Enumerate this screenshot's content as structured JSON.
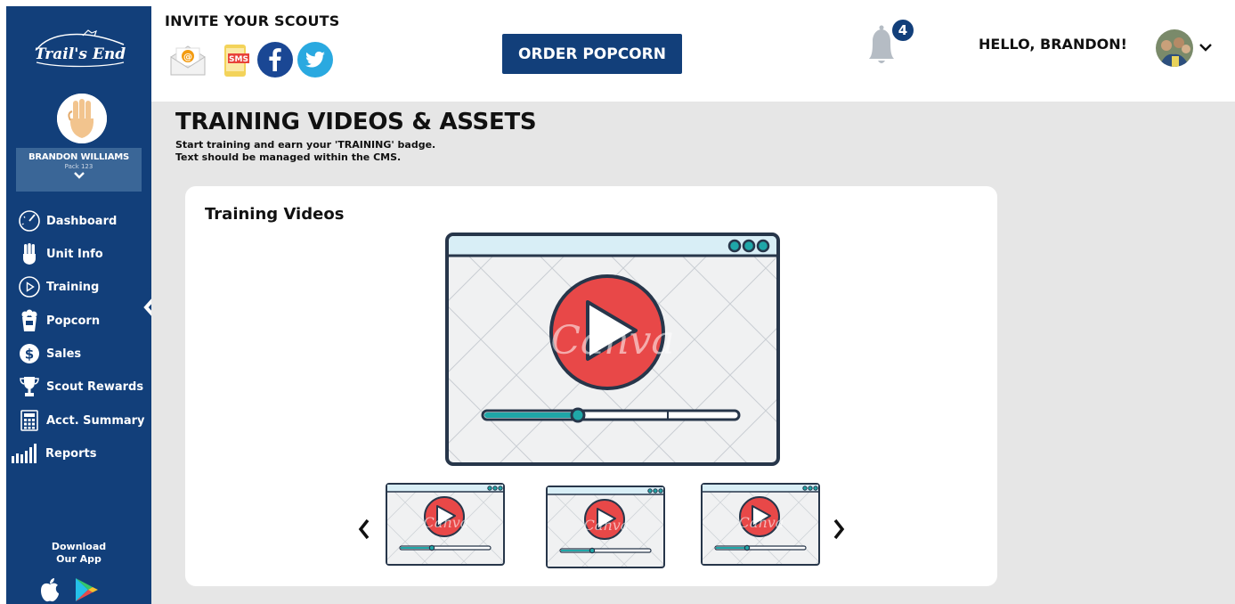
{
  "sidebar": {
    "logo_text": "Trail's End",
    "user": {
      "name": "BRANDON WILLIAMS",
      "pack": "Pack 123"
    },
    "nav": [
      {
        "label": "Dashboard",
        "icon": "dashboard-gauge-icon"
      },
      {
        "label": "Unit Info",
        "icon": "scout-hand-icon"
      },
      {
        "label": "Training",
        "icon": "play-circle-icon"
      },
      {
        "label": "Popcorn",
        "icon": "popcorn-icon"
      },
      {
        "label": "Sales",
        "icon": "dollar-circle-icon"
      },
      {
        "label": "Scout Rewards",
        "icon": "trophy-icon"
      },
      {
        "label": "Acct. Summary",
        "icon": "calculator-icon"
      },
      {
        "label": "Reports",
        "icon": "bar-chart-icon"
      }
    ],
    "download_line1": "Download",
    "download_line2": "Our App"
  },
  "header": {
    "invite_title": "INVITE YOUR SCOUTS",
    "share_icons": [
      "email-icon",
      "sms-icon",
      "facebook-icon",
      "twitter-icon"
    ],
    "sms_label": "SMS",
    "order_button": "ORDER POPCORN",
    "notification_count": "4",
    "greeting": "HELLO, BRANDON!"
  },
  "page": {
    "title": "TRAINING VIDEOS & ASSETS",
    "subtitle_line1": "Start training and earn your 'TRAINING' badge.",
    "subtitle_line2": "Text should be managed within the CMS."
  },
  "training": {
    "section_title": "Training Videos",
    "watermark": "Canva"
  },
  "colors": {
    "brand_navy": "#123f7a",
    "sidebar_user_box": "#3a6697",
    "content_bg": "#e6e6e6",
    "play_red": "#e84848",
    "teal": "#1fa7a8"
  }
}
